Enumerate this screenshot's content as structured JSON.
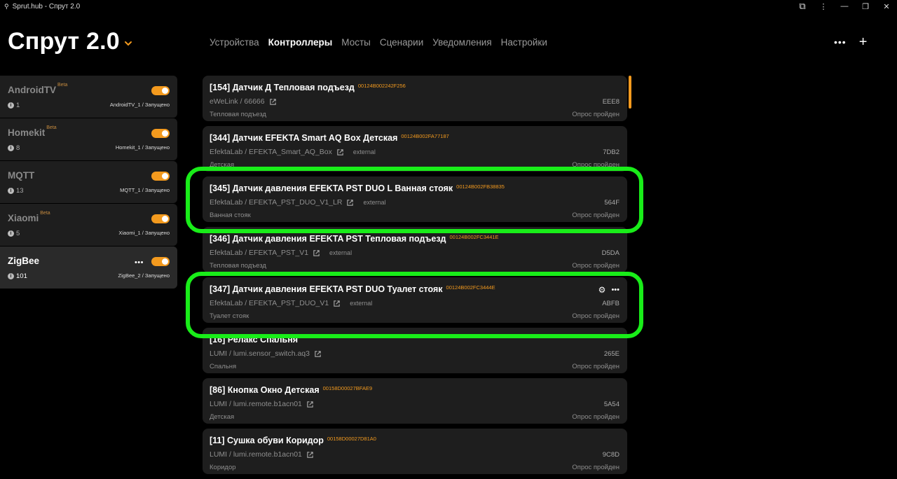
{
  "window": {
    "title": "Sprut.hub - Спрут 2.0",
    "controls": {
      "extension": "⧉",
      "more": "⋮",
      "minimize": "—",
      "restore": "❐",
      "close": "✕"
    }
  },
  "header": {
    "logo": "Спрут 2.0",
    "tabs": [
      {
        "label": "Устройства",
        "active": false
      },
      {
        "label": "Контроллеры",
        "active": true
      },
      {
        "label": "Мосты",
        "active": false
      },
      {
        "label": "Сценарии",
        "active": false
      },
      {
        "label": "Уведомления",
        "active": false
      },
      {
        "label": "Настройки",
        "active": false
      }
    ],
    "more_label": "•••",
    "add_label": "+"
  },
  "sidebar": {
    "items": [
      {
        "name": "AndroidTV",
        "beta": "Beta",
        "count": "1",
        "status": "AndroidTV_1 / Запущено"
      },
      {
        "name": "Homekit",
        "beta": "Beta",
        "count": "8",
        "status": "Homekit_1 / Запущено"
      },
      {
        "name": "MQTT",
        "beta": "",
        "count": "13",
        "status": "MQTT_1 / Запущено"
      },
      {
        "name": "Xiaomi",
        "beta": "Beta",
        "count": "5",
        "status": "Xiaomi_1 / Запущено"
      },
      {
        "name": "ZigBee",
        "beta": "",
        "count": "101",
        "status": "ZigBee_2 / Запущено",
        "more": "•••"
      }
    ]
  },
  "devices": [
    {
      "title": "[154] Датчик Д Тепловая подъезд",
      "id": "00124B002242F256",
      "model": "eWeLink / 66666",
      "tag": "",
      "short": "EEE8",
      "room": "Тепловая подъезд",
      "status": "Опрос пройден"
    },
    {
      "title": "[344] Датчик EFEKTA Smart AQ Box Детская",
      "id": "00124B002FA77187",
      "model": "EfektaLab / EFEKTA_Smart_AQ_Box",
      "tag": "external",
      "short": "7DB2",
      "room": "Детская",
      "status": "Опрос пройден"
    },
    {
      "title": "[345] Датчик давления EFEKTA PST DUO L Ванная стояк",
      "id": "00124B002FB38835",
      "model": "EfektaLab / EFEKTA_PST_DUO_V1_LR",
      "tag": "external",
      "short": "564F",
      "room": "Ванная стояк",
      "status": "Опрос пройден"
    },
    {
      "title": "[346] Датчик давления EFEKTA PST Тепловая подъезд",
      "id": "00124B002FC3441E",
      "model": "EfektaLab / EFEKTA_PST_V1",
      "tag": "external",
      "short": "D5DA",
      "room": "Тепловая подъезд",
      "status": "Опрос пройден"
    },
    {
      "title": "[347] Датчик давления EFEKTA PST DUO Туалет стояк",
      "id": "00124B002FC3444E",
      "model": "EfektaLab / EFEKTA_PST_DUO_V1",
      "tag": "external",
      "short": "ABFB",
      "room": "Туалет стояк",
      "status": "Опрос пройден",
      "actions": {
        "gear": "⚙",
        "more": "•••"
      }
    },
    {
      "title": "[16] Релакс Спальня",
      "id": "",
      "model": "LUMI / lumi.sensor_switch.aq3",
      "tag": "",
      "short": "265E",
      "room": "Спальня",
      "status": "Опрос пройден"
    },
    {
      "title": "[86] Кнопка Окно Детская",
      "id": "00158D00027BFAE9",
      "model": "LUMI / lumi.remote.b1acn01",
      "tag": "",
      "short": "5A54",
      "room": "Детская",
      "status": "Опрос пройден"
    },
    {
      "title": "[11] Сушка обуви Коридор",
      "id": "00158D00027D81A0",
      "model": "LUMI / lumi.remote.b1acn01",
      "tag": "",
      "short": "9C8D",
      "room": "Коридор",
      "status": "Опрос пройден"
    }
  ],
  "colors": {
    "accent": "#f39a1e",
    "highlight": "#19ed19",
    "card": "#1e1e1e",
    "background": "#000000"
  }
}
